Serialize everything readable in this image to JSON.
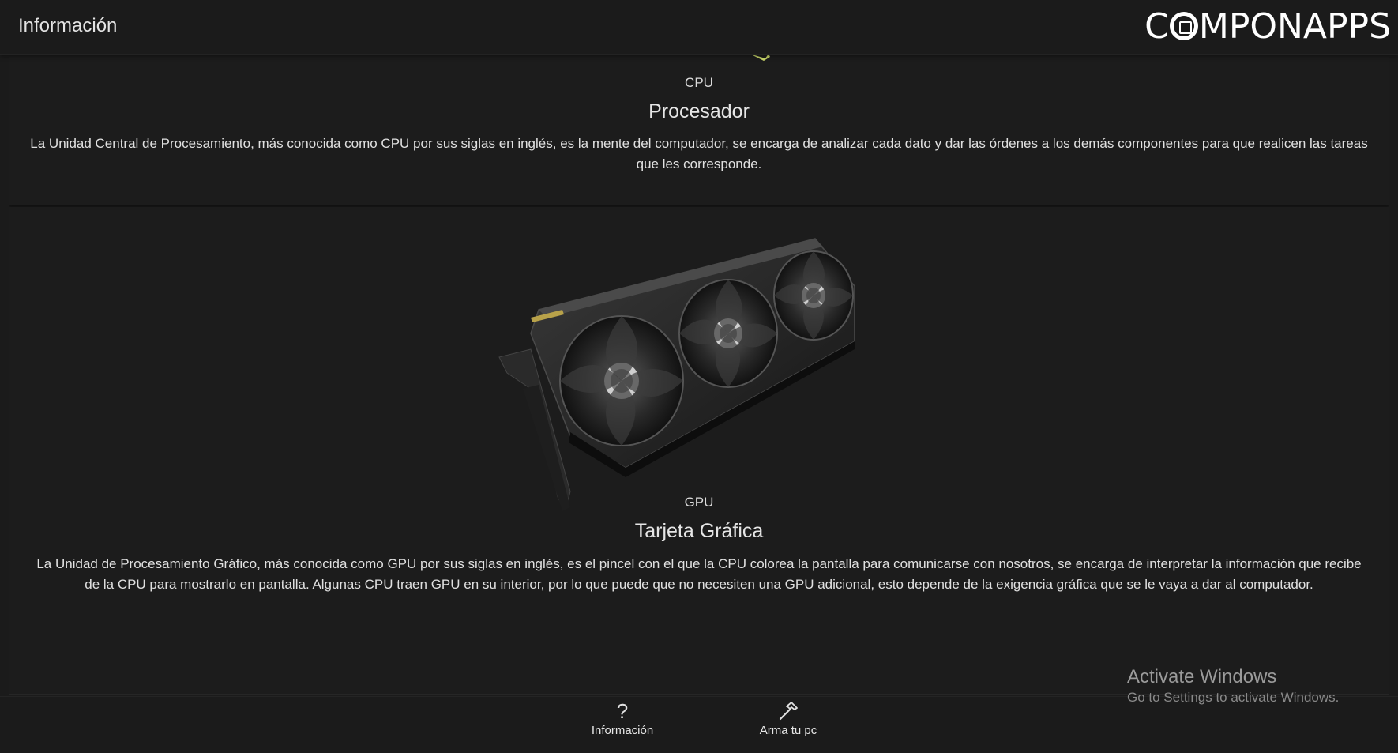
{
  "header": {
    "title": "Información",
    "brand": {
      "before": "C",
      "after": "MPONAPPS"
    }
  },
  "cards": [
    {
      "tag": "CPU",
      "heading": "Procesador",
      "description": "La Unidad Central de Procesamiento, más conocida como CPU por sus siglas en inglés, es la mente del computador, se encarga de analizar cada dato y dar las órdenes a los demás componentes para que realicen las tareas que les corresponde."
    },
    {
      "tag": "GPU",
      "heading": "Tarjeta Gráfica",
      "description": "La Unidad de Procesamiento Gráfico, más conocida como GPU por sus siglas en inglés, es el pincel con el que la CPU colorea la pantalla para comunicarse con nosotros, se encarga de interpretar la información que recibe de la CPU para mostrarlo en pantalla. Algunas CPU traen GPU en su interior, por lo que puede que no necesiten una GPU adicional, esto depende de la exigencia gráfica que se le vaya a dar al computador."
    }
  ],
  "bottom_nav": [
    {
      "label": "Información",
      "icon": "question-mark-icon"
    },
    {
      "label": "Arma tu pc",
      "icon": "hammer-icon"
    }
  ],
  "watermark": {
    "title": "Activate Windows",
    "subtitle": "Go to Settings to activate Windows."
  }
}
